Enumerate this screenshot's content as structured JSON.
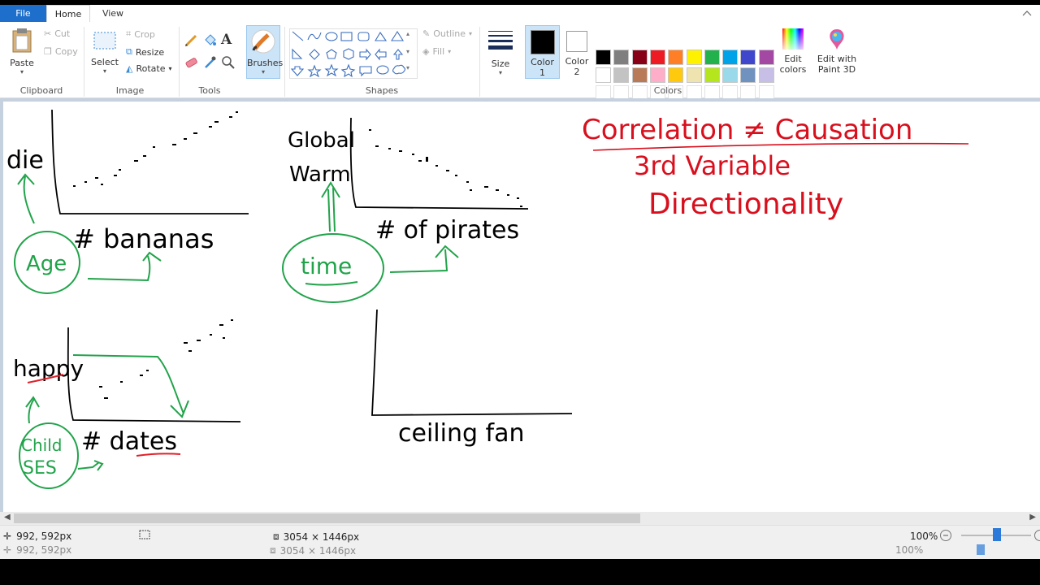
{
  "tabs": {
    "file": "File",
    "home": "Home",
    "view": "View"
  },
  "clipboard": {
    "paste": "Paste",
    "cut": "Cut",
    "copy": "Copy",
    "label": "Clipboard"
  },
  "image": {
    "select": "Select",
    "crop": "Crop",
    "resize": "Resize",
    "rotate": "Rotate",
    "label": "Image"
  },
  "tools": {
    "label": "Tools"
  },
  "brushes": {
    "label": "Brushes"
  },
  "shapes": {
    "outline": "Outline",
    "fill": "Fill",
    "label": "Shapes"
  },
  "size": {
    "label": "Size"
  },
  "color1": {
    "label1": "Color",
    "label2": "1"
  },
  "color2": {
    "label1": "Color",
    "label2": "2"
  },
  "colors": {
    "label": "Colors",
    "row1": [
      "#000000",
      "#7f7f7f",
      "#880015",
      "#ed1c24",
      "#ff7f27",
      "#fff200",
      "#22b14c",
      "#00a2e8",
      "#3f48cc",
      "#a349a4"
    ],
    "row2": [
      "#ffffff",
      "#c3c3c3",
      "#b97a57",
      "#ffaec9",
      "#ffc90e",
      "#efe4b0",
      "#b5e61d",
      "#99d9ea",
      "#7092be",
      "#c8bfe7"
    ],
    "edit": [
      "Edit",
      "colors"
    ],
    "paint3d": [
      "Edit with",
      "Paint 3D"
    ]
  },
  "drawing": {
    "graph1": {
      "y": "die",
      "x": "# bananas",
      "third": "Age"
    },
    "graph2": {
      "y1": "Global",
      "y2": "Warm",
      "x": "# of pirates",
      "third": "time"
    },
    "graph3": {
      "y": "happy",
      "x": "# dates",
      "third1": "Child",
      "third2": "SES"
    },
    "graph4": {
      "x": "ceiling fan"
    },
    "notes": {
      "title": "Correlation ≠ Causation",
      "line2": "3rd Variable",
      "line3": "Directionality"
    }
  },
  "status": {
    "cursor": "992, 592px",
    "canvas_size": "3054 × 1446px",
    "zoom": "100%"
  }
}
